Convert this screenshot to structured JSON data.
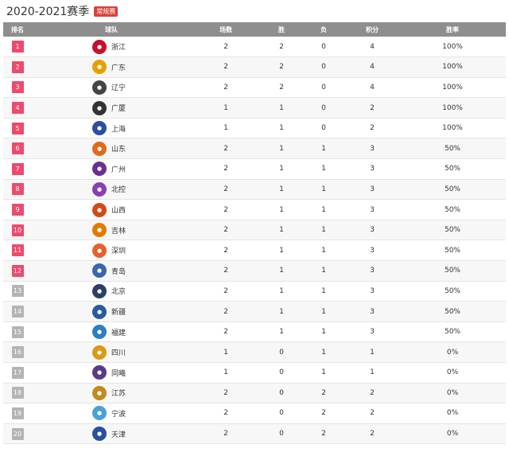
{
  "header": {
    "season": "2020-2021赛季",
    "badge": "常规赛"
  },
  "columns": [
    "排名",
    "球队",
    "场数",
    "胜",
    "负",
    "积分",
    "胜率"
  ],
  "rows": [
    {
      "rank": "1",
      "team": "浙江",
      "games": "2",
      "wins": "2",
      "losses": "0",
      "points": "4",
      "pct": "100%",
      "logo_color": "#c8102e"
    },
    {
      "rank": "2",
      "team": "广东",
      "games": "2",
      "wins": "2",
      "losses": "0",
      "points": "4",
      "pct": "100%",
      "logo_color": "#e5a100"
    },
    {
      "rank": "3",
      "team": "辽宁",
      "games": "2",
      "wins": "2",
      "losses": "0",
      "points": "4",
      "pct": "100%",
      "logo_color": "#444444"
    },
    {
      "rank": "4",
      "team": "广厦",
      "games": "1",
      "wins": "1",
      "losses": "0",
      "points": "2",
      "pct": "100%",
      "logo_color": "#333333"
    },
    {
      "rank": "5",
      "team": "上海",
      "games": "1",
      "wins": "1",
      "losses": "0",
      "points": "2",
      "pct": "100%",
      "logo_color": "#2b4ea2"
    },
    {
      "rank": "6",
      "team": "山东",
      "games": "2",
      "wins": "1",
      "losses": "1",
      "points": "3",
      "pct": "50%",
      "logo_color": "#e06b1a"
    },
    {
      "rank": "7",
      "team": "广州",
      "games": "2",
      "wins": "1",
      "losses": "1",
      "points": "3",
      "pct": "50%",
      "logo_color": "#6a2f8f"
    },
    {
      "rank": "8",
      "team": "北控",
      "games": "2",
      "wins": "1",
      "losses": "1",
      "points": "3",
      "pct": "50%",
      "logo_color": "#8a3fb5"
    },
    {
      "rank": "9",
      "team": "山西",
      "games": "2",
      "wins": "1",
      "losses": "1",
      "points": "3",
      "pct": "50%",
      "logo_color": "#d24a16"
    },
    {
      "rank": "10",
      "team": "吉林",
      "games": "2",
      "wins": "1",
      "losses": "1",
      "points": "3",
      "pct": "50%",
      "logo_color": "#e07b00"
    },
    {
      "rank": "11",
      "team": "深圳",
      "games": "2",
      "wins": "1",
      "losses": "1",
      "points": "3",
      "pct": "50%",
      "logo_color": "#e8602c"
    },
    {
      "rank": "12",
      "team": "青岛",
      "games": "2",
      "wins": "1",
      "losses": "1",
      "points": "3",
      "pct": "50%",
      "logo_color": "#3a66b0"
    },
    {
      "rank": "13",
      "team": "北京",
      "games": "2",
      "wins": "1",
      "losses": "1",
      "points": "3",
      "pct": "50%",
      "logo_color": "#2c3e66"
    },
    {
      "rank": "14",
      "team": "新疆",
      "games": "2",
      "wins": "1",
      "losses": "1",
      "points": "3",
      "pct": "50%",
      "logo_color": "#2a5b9a"
    },
    {
      "rank": "15",
      "team": "福建",
      "games": "2",
      "wins": "1",
      "losses": "1",
      "points": "3",
      "pct": "50%",
      "logo_color": "#2e7fc2"
    },
    {
      "rank": "16",
      "team": "四川",
      "games": "1",
      "wins": "0",
      "losses": "1",
      "points": "1",
      "pct": "0%",
      "logo_color": "#d99a14"
    },
    {
      "rank": "17",
      "team": "同曦",
      "games": "1",
      "wins": "0",
      "losses": "1",
      "points": "1",
      "pct": "0%",
      "logo_color": "#5a3a8a"
    },
    {
      "rank": "18",
      "team": "江苏",
      "games": "2",
      "wins": "0",
      "losses": "2",
      "points": "2",
      "pct": "0%",
      "logo_color": "#c18b1a"
    },
    {
      "rank": "19",
      "team": "宁波",
      "games": "2",
      "wins": "0",
      "losses": "2",
      "points": "2",
      "pct": "0%",
      "logo_color": "#4aa0d8"
    },
    {
      "rank": "20",
      "team": "天津",
      "games": "2",
      "wins": "0",
      "losses": "2",
      "points": "2",
      "pct": "0%",
      "logo_color": "#2c4f9e"
    }
  ]
}
